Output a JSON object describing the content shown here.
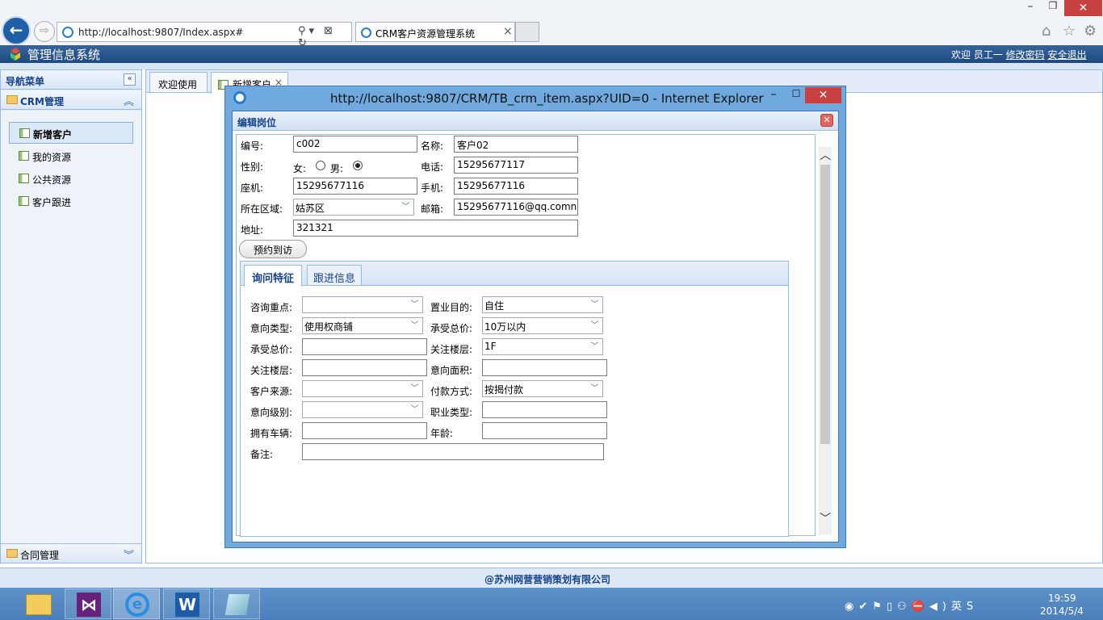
{
  "browser": {
    "address": "http://localhost:9807/Index.aspx#",
    "tab_title": "CRM客户资源管理系统",
    "tab_close": "×",
    "back_glyph": "←",
    "forward_glyph": "⇨",
    "addr_tools": "⚲▾ ⊠ ↻",
    "min_glyph": "–",
    "max_glyph": "❐",
    "close_glyph": "✕",
    "home_glyph": "⌂",
    "star_glyph": "☆",
    "gear_glyph": "⚙"
  },
  "app": {
    "title": "管理信息系统",
    "welcome": "欢迎 员工一",
    "change_password": "修改密码",
    "logout": "安全退出"
  },
  "sidebar": {
    "title": "导航菜单",
    "collapse_glyph": "«",
    "group_crm": {
      "label": "CRM管理",
      "toggle": "︽"
    },
    "items": [
      {
        "label": "新增客户"
      },
      {
        "label": "我的资源"
      },
      {
        "label": "公共资源"
      },
      {
        "label": "客户跟进"
      }
    ],
    "group_contract": {
      "label": "合同管理",
      "toggle": "︾"
    }
  },
  "main_tabs": [
    {
      "label": "欢迎使用"
    },
    {
      "label": "新增客户",
      "close": "×"
    }
  ],
  "dialog": {
    "title": "http://localhost:9807/CRM/TB_crm_item.aspx?UID=0 - Internet Explorer",
    "min_glyph": "–",
    "max_glyph": "☐",
    "close_glyph": "✕",
    "panel_title": "编辑岗位",
    "panel_close": "✕",
    "scroll_up": "︿",
    "scroll_down": "﹀",
    "form": {
      "code_label": "编号:",
      "code_value": "c002",
      "name_label": "名称:",
      "name_value": "客户02",
      "gender_label": "性别:",
      "female_label": "女:",
      "male_label": "男:",
      "gender_selected": "男",
      "phone_label": "电话:",
      "phone_value": "15295677117",
      "landline_label": "座机:",
      "landline_value": "15295677116",
      "mobile_label": "手机:",
      "mobile_value": "15295677116",
      "region_label": "所在区域:",
      "region_value": "姑苏区",
      "email_label": "邮箱:",
      "email_value": "15295677116@qq.comn",
      "address_label": "地址:",
      "address_value": "321321",
      "visit_button": "预约到访"
    },
    "inner_tabs": [
      {
        "label": "询问特征"
      },
      {
        "label": "跟进信息"
      }
    ],
    "features": {
      "consult_focus_label": "咨询重点:",
      "consult_focus_value": "",
      "purpose_label": "置业目的:",
      "purpose_value": "自住",
      "intent_type_label": "意向类型:",
      "intent_type_value": "使用权商铺",
      "total_price_label": "承受总价:",
      "total_price_value": "10万以内",
      "total_price2_label": "承受总价:",
      "total_price2_value": "",
      "floor_label": "关注楼层:",
      "floor_value": "1F",
      "floor2_label": "关注楼层:",
      "floor2_value": "",
      "area_label": "意向面积:",
      "area_value": "",
      "source_label": "客户来源:",
      "source_value": "",
      "payment_label": "付款方式:",
      "payment_value": "按揭付款",
      "level_label": "意向级别:",
      "level_value": "",
      "job_label": "职业类型:",
      "job_value": "",
      "car_label": "拥有车辆:",
      "car_value": "",
      "age_label": "年龄:",
      "age_value": "",
      "note_label": "备注:",
      "note_value": ""
    },
    "dropdown_arrow": "﹀"
  },
  "footer": {
    "text": "@苏州网营营销策划有限公司"
  },
  "taskbar": {
    "vs_glyph": "⋈",
    "ie_glyph": "e",
    "word_glyph": "W",
    "tray": "◉✔⚑▯⚇⛔◀)英S",
    "time": "19:59",
    "date": "2014/5/4"
  }
}
